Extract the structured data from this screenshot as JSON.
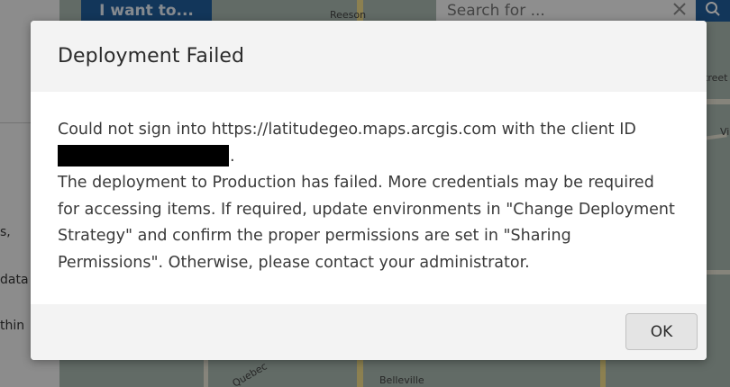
{
  "background": {
    "want_button_label": "I want to...",
    "search_placeholder": "Search for ...",
    "left_panel_fragments": [
      "s,",
      "data",
      "thin"
    ],
    "map_labels": [
      "Reeson",
      "treet",
      "Vi",
      "Quebec",
      "Belleville"
    ]
  },
  "dialog": {
    "title": "Deployment Failed",
    "message_line1": "Could not sign into https://latitudegeo.maps.arcgis.com with the client ID",
    "message_line1_end": ".",
    "message_paragraph2": "The deployment to Production has failed. More credentials may be required for accessing items. If required, update environments in \"Change Deployment Strategy\" and confirm the proper permissions are set in \"Sharing Permissions\". Otherwise, please contact your administrator.",
    "ok_label": "OK"
  },
  "icons": {
    "close": "close-icon",
    "search": "search-icon"
  },
  "colors": {
    "accent_blue": "#1f5d9b",
    "dialog_header_bg": "#f3f3f3",
    "redaction": "#000000"
  }
}
